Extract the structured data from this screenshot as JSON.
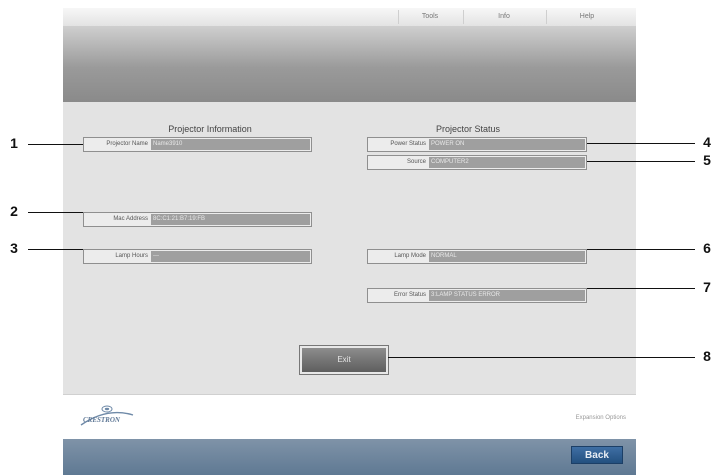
{
  "menu": {
    "tools": "Tools",
    "info": "Info",
    "help": "Help"
  },
  "projector_info": {
    "title": "Projector Information",
    "name_label": "Projector Name",
    "name_value": "Name3910",
    "mac_label": "Mac Address",
    "mac_value": "8C:C1:21:B7:19:FB",
    "lamp_hours_label": "Lamp Hours",
    "lamp_hours_value": "---"
  },
  "projector_status": {
    "title": "Projector Status",
    "power_label": "Power Status",
    "power_value": "POWER ON",
    "source_label": "Source",
    "source_value": "COMPUTER2",
    "lamp_mode_label": "Lamp Mode",
    "lamp_mode_value": "NORMAL",
    "error_label": "Error Status",
    "error_value": "3:LAMP STATUS ERROR"
  },
  "exit_label": "Exit",
  "footer": {
    "logo_text": "CRESTRON",
    "expansion": "Expansion Options"
  },
  "back_label": "Back",
  "callouts": [
    "1",
    "2",
    "3",
    "4",
    "5",
    "6",
    "7",
    "8"
  ]
}
